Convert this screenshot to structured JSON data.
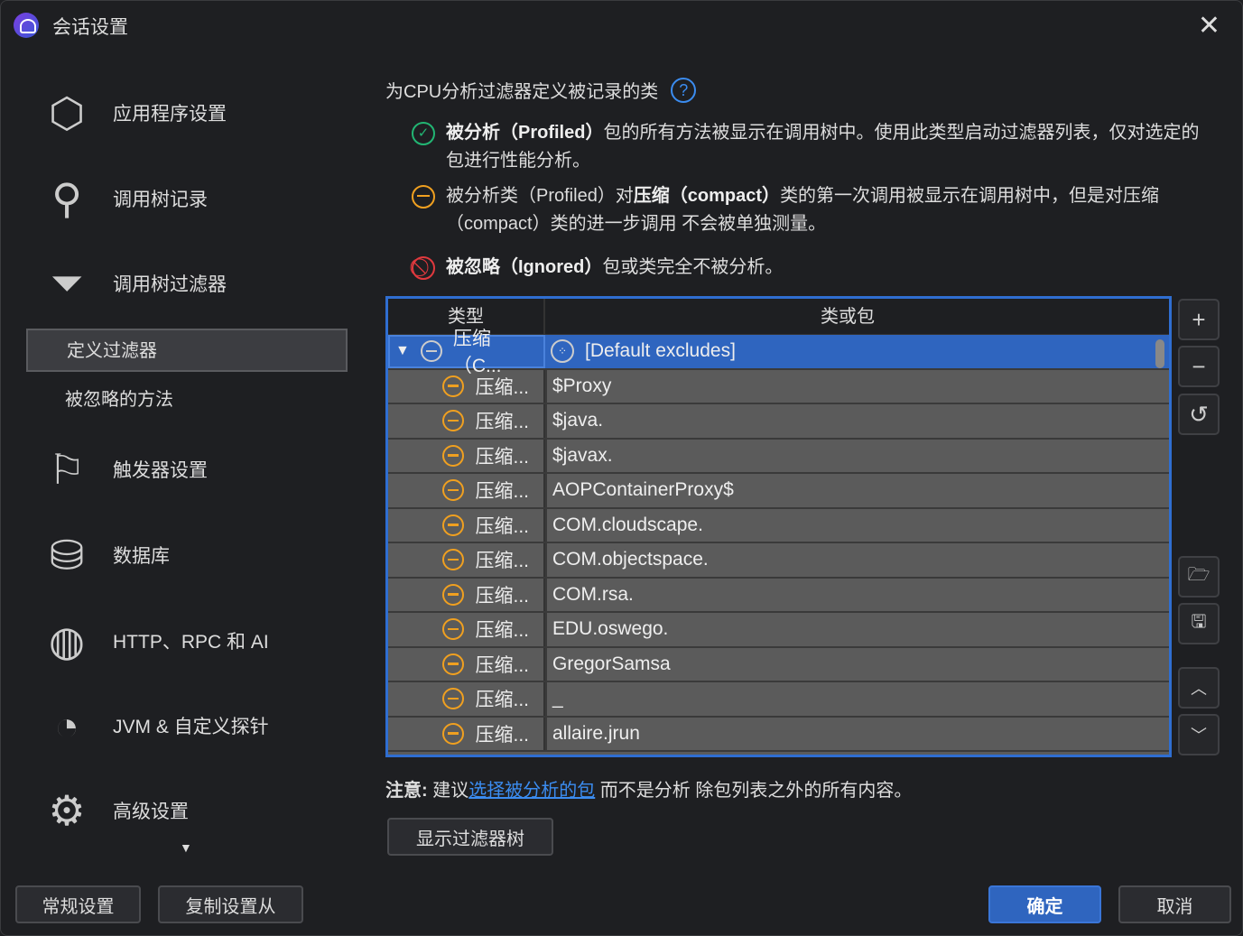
{
  "window": {
    "title": "会话设置"
  },
  "nav": [
    {
      "label": "应用程序设置",
      "icon": "cube-icon"
    },
    {
      "label": "调用树记录",
      "icon": "tree-icon"
    },
    {
      "label": "调用树过滤器",
      "icon": "filter-icon"
    },
    {
      "label": "触发器设置",
      "icon": "flag-icon"
    },
    {
      "label": "数据库",
      "icon": "database-icon"
    },
    {
      "label": "HTTP、RPC 和 AI",
      "icon": "globe-icon"
    },
    {
      "label": "JVM & 自定义探针",
      "icon": "gauge-icon"
    },
    {
      "label": "高级设置",
      "icon": "gears-icon"
    }
  ],
  "subnav": [
    {
      "label": "定义过滤器",
      "selected": true
    },
    {
      "label": "被忽略的方法"
    }
  ],
  "main": {
    "heading": "为CPU分析过滤器定义被记录的类",
    "help": "?",
    "legend": [
      {
        "bold": "被分析（Profiled）",
        "text": "包的所有方法被显示在调用树中。使用此类型启动过滤器列表，仅对选定的包进行性能分析。",
        "color": "#22b573"
      },
      {
        "pre": "被分析类（Profiled）对",
        "bold": "压缩（compact）",
        "text": "类的第一次调用被显示在调用树中，但是对压缩（compact）类的进一步调用 不会被单独测量。",
        "color": "#f0a020"
      },
      {
        "bold": "被忽略（Ignored）",
        "text": "包或类完全不被分析。",
        "color": "#e0393e"
      }
    ],
    "table": {
      "headers": [
        "类型",
        "类或包"
      ],
      "rows": [
        {
          "type": "压缩（C...",
          "value": "[Default excludes]",
          "group": true
        },
        {
          "type": "压缩...",
          "value": "$Proxy"
        },
        {
          "type": "压缩...",
          "value": "$java."
        },
        {
          "type": "压缩...",
          "value": "$javax."
        },
        {
          "type": "压缩...",
          "value": "AOPContainerProxy$"
        },
        {
          "type": "压缩...",
          "value": "COM.cloudscape."
        },
        {
          "type": "压缩...",
          "value": "COM.objectspace."
        },
        {
          "type": "压缩...",
          "value": "COM.rsa."
        },
        {
          "type": "压缩...",
          "value": "EDU.oswego."
        },
        {
          "type": "压缩...",
          "value": "GregorSamsa"
        },
        {
          "type": "压缩...",
          "value": "_"
        },
        {
          "type": "压缩...",
          "value": "allaire.jrun"
        }
      ]
    },
    "note": {
      "label": "注意:",
      "pre": "建议",
      "link": "选择被分析的包",
      "post": " 而不是分析 除包列表之外的所有内容。"
    },
    "show_tree": "显示过滤器树"
  },
  "footer": {
    "general": "常规设置",
    "copy": "复制设置从",
    "ok": "确定",
    "cancel": "取消"
  }
}
